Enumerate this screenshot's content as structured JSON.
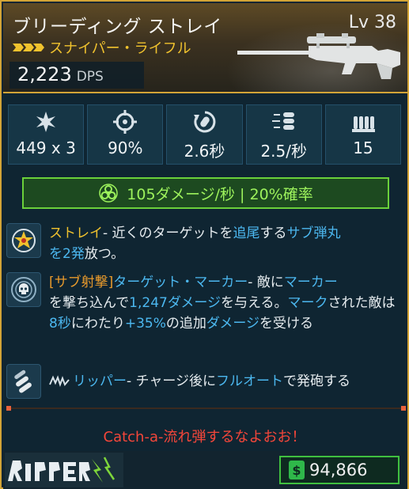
{
  "header": {
    "weapon_name": "ブリーディング ストレイ",
    "level": "Lv 38",
    "weapon_type": "スナイパー・ライフル",
    "dps_value": "2,223",
    "dps_unit": "DPS",
    "rarity_color": "#f0c22e"
  },
  "stats": [
    {
      "icon": "damage-icon",
      "value": "449 x 3"
    },
    {
      "icon": "accuracy-crosshair-icon",
      "value": "90%"
    },
    {
      "icon": "reload-icon",
      "value": "2.6秒"
    },
    {
      "icon": "fire-rate-icon",
      "value": "2.5/秒"
    },
    {
      "icon": "magazine-ammo-icon",
      "value": "15"
    }
  ],
  "element": {
    "icon": "corrosive-biohazard-icon",
    "text": "105ダメージ/秒 | 20%確率",
    "color": "#9df25c"
  },
  "perks": [
    {
      "icon": "star-target-icon",
      "parts": [
        "ストレイ",
        "- 近くのターゲットを",
        "追尾",
        "する",
        "サブ弾丸",
        "を2発",
        "放つ。"
      ]
    },
    {
      "icon": "skull-target-icon",
      "parts": [
        "[サブ射撃]",
        "ターゲット・マーカー",
        "- 敵に",
        "マーカー",
        "を撃ち込んで",
        "1,247ダメージ",
        "を与える。",
        "マーク",
        "された敵は",
        "8秒",
        "にわたり",
        "+35%",
        "の追加",
        "ダメージ",
        "を受ける"
      ]
    },
    {
      "icon": "bullets-icon",
      "parts": [
        "リッパー",
        "- チャージ後に",
        "フルオート",
        "で発砲する"
      ]
    }
  ],
  "flavor_text": "Catch-a-流れ弾するなよおお！",
  "footer": {
    "manufacturer_logo": "RIPPER",
    "price": "94,866",
    "currency_icon": "dollar-icon"
  }
}
